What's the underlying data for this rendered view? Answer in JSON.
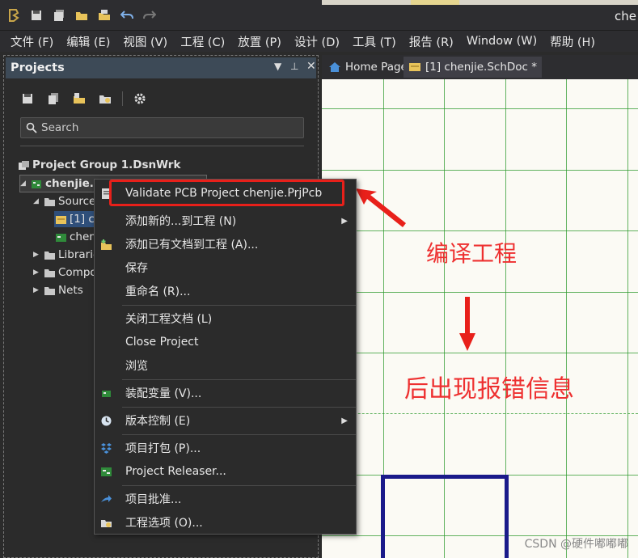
{
  "window": {
    "title_partial": "che"
  },
  "menubar": {
    "items": [
      "文件 (F)",
      "编辑 (E)",
      "视图 (V)",
      "工程 (C)",
      "放置 (P)",
      "设计 (D)",
      "工具 (T)",
      "报告 (R)",
      "Window (W)",
      "帮助 (H)"
    ]
  },
  "panel": {
    "title": "Projects",
    "search_placeholder": "Search",
    "tree": {
      "group": "Project Group 1.DsnWrk",
      "project": "chenjie.PrjPcb",
      "source_folder": "Source",
      "doc_sch": "[1] c",
      "doc_pcb": "chen",
      "libraries": "Librarie",
      "components": "Compo",
      "nets": "Nets"
    }
  },
  "tabs": [
    {
      "label": "Home Page",
      "active": false
    },
    {
      "label": "[1] chenjie.SchDoc *",
      "active": true
    }
  ],
  "context_menu": {
    "items": [
      {
        "label": "Validate PCB Project chenjie.PrjPcb",
        "icon": "validate-icon",
        "submenu": false
      },
      {
        "label": "添加新的...到工程 (N)",
        "icon": "",
        "submenu": true
      },
      {
        "label": "添加已有文档到工程 (A)...",
        "icon": "add-existing-icon",
        "submenu": false
      },
      {
        "label": "保存",
        "icon": "",
        "submenu": false
      },
      {
        "label": "重命名 (R)...",
        "icon": "",
        "submenu": false
      },
      {
        "label": "关闭工程文档 (L)",
        "icon": "",
        "submenu": false
      },
      {
        "label": "Close Project",
        "icon": "",
        "submenu": false
      },
      {
        "label": "浏览",
        "icon": "",
        "submenu": false
      },
      {
        "label": "装配变量 (V)...",
        "icon": "variant-icon",
        "submenu": false
      },
      {
        "label": "版本控制 (E)",
        "icon": "clock-icon",
        "submenu": true
      },
      {
        "label": "项目打包 (P)...",
        "icon": "package-icon",
        "submenu": false
      },
      {
        "label": "Project Releaser...",
        "icon": "releaser-icon",
        "submenu": false
      },
      {
        "label": "项目批准...",
        "icon": "approve-icon",
        "submenu": false
      },
      {
        "label": "工程选项 (O)...",
        "icon": "options-icon",
        "submenu": false
      }
    ]
  },
  "annotations": {
    "compile": "编译工程",
    "errors": "后出现报错信息",
    "color": "#ee3030"
  },
  "watermark": "CSDN @硬件嘟嘟嘟",
  "colors": {
    "panel_header": "#3d4a57",
    "sheet_background": "#fbfaf4",
    "grid": "#2e9a2e",
    "component_outline": "#1a1a8a",
    "highlight_box": "#e8201a"
  }
}
